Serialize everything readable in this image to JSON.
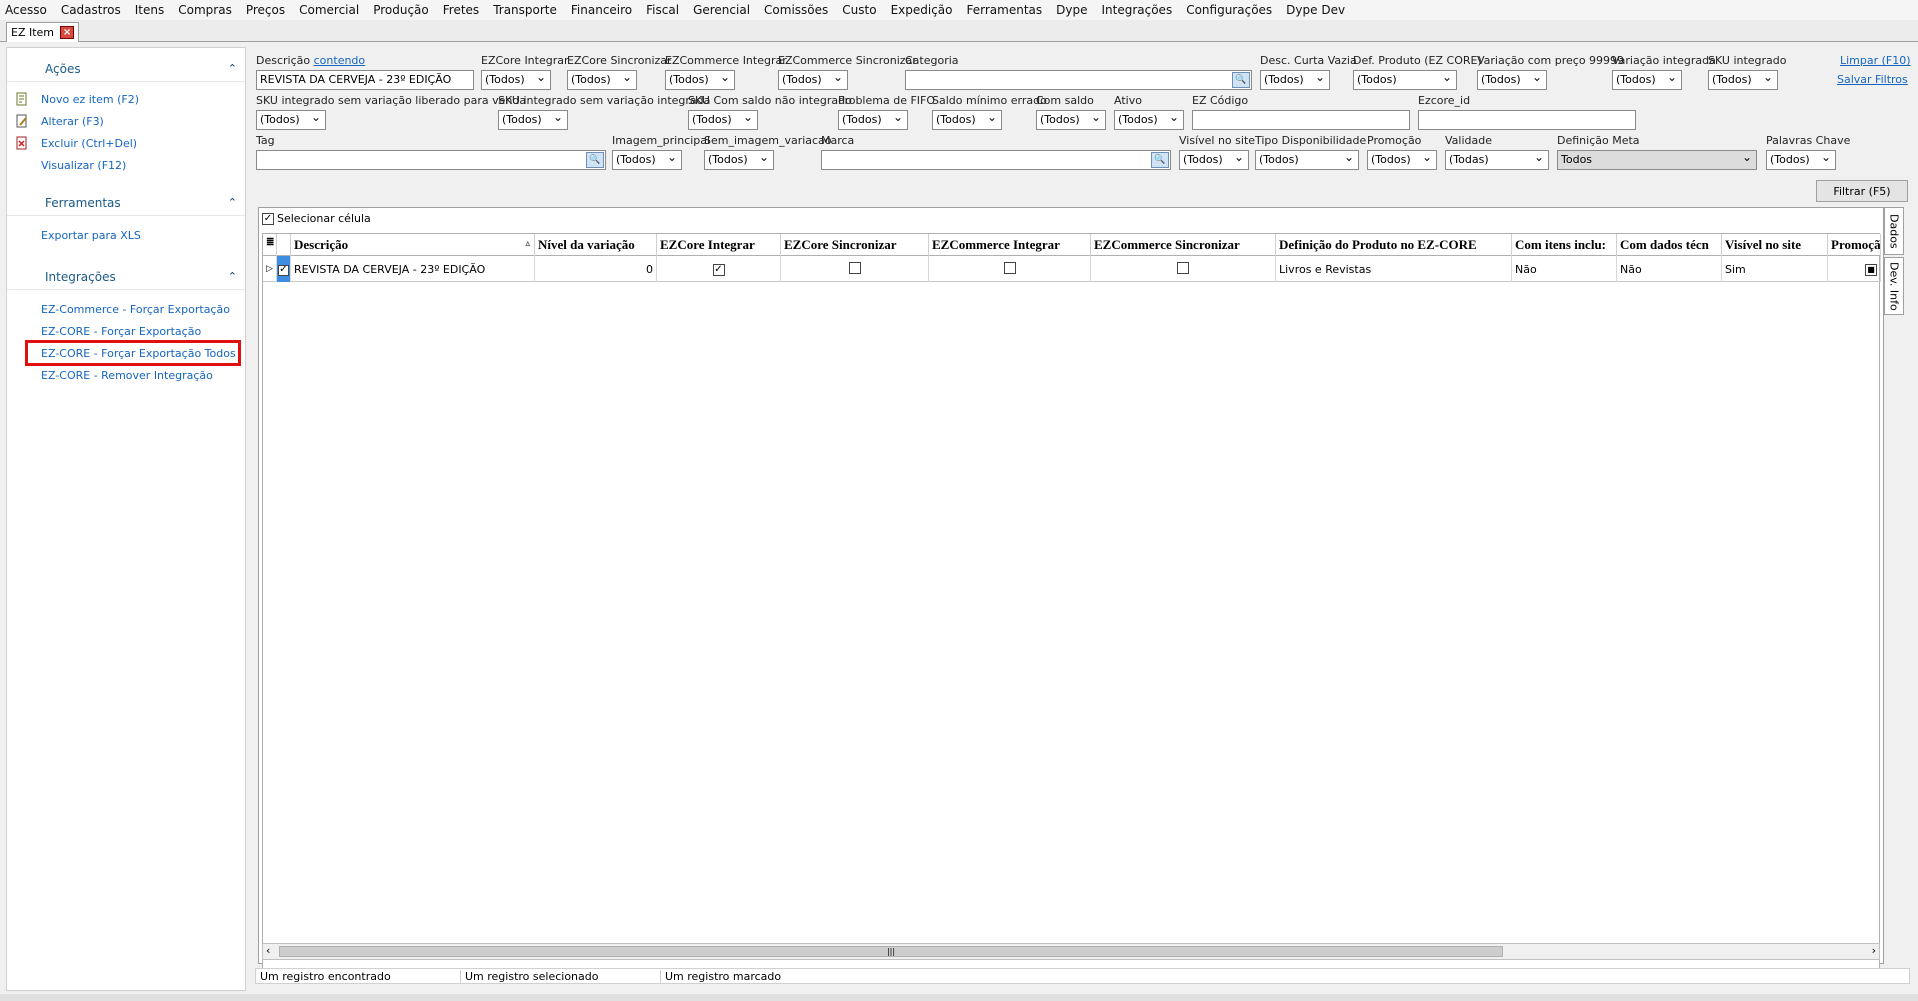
{
  "menu": [
    "Acesso",
    "Cadastros",
    "Itens",
    "Compras",
    "Preços",
    "Comercial",
    "Produção",
    "Fretes",
    "Transporte",
    "Financeiro",
    "Fiscal",
    "Gerencial",
    "Comissões",
    "Custo",
    "Expedição",
    "Ferramentas",
    "Dype",
    "Integrações",
    "Configurações",
    "Dype Dev"
  ],
  "tab": {
    "label": "EZ Item"
  },
  "sidebar": {
    "acoes": {
      "title": "Ações",
      "items": [
        "Novo ez item (F2)",
        "Alterar (F3)",
        "Excluir (Ctrl+Del)",
        "Visualizar (F12)"
      ]
    },
    "ferramentas": {
      "title": "Ferramentas",
      "items": [
        "Exportar para XLS"
      ]
    },
    "integracoes": {
      "title": "Integrações",
      "items": [
        "EZ-Commerce - Forçar Exportação",
        "EZ-CORE - Forçar Exportação",
        "EZ-CORE - Forçar Exportação Todos",
        "EZ-CORE - Remover Integração"
      ]
    }
  },
  "filters": {
    "descricao": {
      "label": "Descrição",
      "mode": "contendo",
      "value": "REVISTA DA CERVEJA - 23º EDIÇÃO"
    },
    "ezcore_integrar": {
      "label": "EZCore Integrar",
      "value": "(Todos)"
    },
    "ezcore_sincronizar": {
      "label": "EZCore Sincronizar",
      "value": "(Todos)"
    },
    "ezcommerce_integrar": {
      "label": "EZCommerce Integrar",
      "value": "(Todos)"
    },
    "ezcommerce_sincronizar": {
      "label": "EZCommerce Sincronizar",
      "value": "(Todos)"
    },
    "categoria": {
      "label": "Categoria",
      "value": ""
    },
    "desc_curta_vazia": {
      "label": "Desc. Curta Vazia",
      "value": "(Todos)"
    },
    "def_produto": {
      "label": "Def. Produto (EZ CORE)",
      "value": "(Todos)"
    },
    "variacao_preco": {
      "label": "Variação com preço 99999",
      "value": "(Todos)"
    },
    "variacao_integrada": {
      "label": "Variação integrada",
      "value": "(Todos)"
    },
    "sku_integrado": {
      "label": "SKU integrado",
      "value": "(Todos)"
    },
    "limpar": "Limpar (F10)",
    "salvar": "Salvar Filtros",
    "sku_sem_var": {
      "label": "SKU integrado sem variação liberado para venda",
      "value": "(Todos)"
    },
    "sku_sem_var_int": {
      "label": "SKU integrado sem variação integrada",
      "value": "(Todos)"
    },
    "sku_saldo": {
      "label": "SKU Com saldo não integrado",
      "value": "(Todos)"
    },
    "fifo": {
      "label": "Problema de FIFO",
      "value": "(Todos)"
    },
    "saldo_min": {
      "label": "Saldo mínimo errado",
      "value": "(Todos)"
    },
    "com_saldo": {
      "label": "Com saldo",
      "value": "(Todos)"
    },
    "ativo": {
      "label": "Ativo",
      "value": "(Todos)"
    },
    "ez_codigo": {
      "label": "EZ Código",
      "value": ""
    },
    "ezcore_id": {
      "label": "Ezcore_id",
      "value": ""
    },
    "tag": {
      "label": "Tag",
      "value": ""
    },
    "imagem_principal": {
      "label": "Imagem_principal",
      "value": "(Todos)"
    },
    "sem_imagem": {
      "label": "Sem_imagem_variacao",
      "value": "(Todos)"
    },
    "marca": {
      "label": "Marca",
      "value": ""
    },
    "visivel_site": {
      "label": "Visível no site",
      "value": "(Todos)"
    },
    "tipo_disp": {
      "label": "Tipo Disponibilidade",
      "value": "(Todos)"
    },
    "promocao": {
      "label": "Promoção",
      "value": "(Todos)"
    },
    "validade": {
      "label": "Validade",
      "value": "(Todas)"
    },
    "def_meta": {
      "label": "Definição Meta",
      "value": "Todos"
    },
    "palavras_chave": {
      "label": "Palavras Chave",
      "value": "(Todos)"
    },
    "filtrar": "Filtrar (F5)"
  },
  "grid": {
    "select_cell": "Selecionar célula",
    "columns": [
      "Descrição",
      "Nível da variação",
      "EZCore Integrar",
      "EZCore Sincronizar",
      "EZCommerce Integrar",
      "EZCommerce Sincronizar",
      "Definição do Produto no EZ-CORE",
      "Com itens inclu:",
      "Com dados técn",
      "Visível no site",
      "Promoçã"
    ],
    "row": {
      "descricao": "REVISTA DA CERVEJA - 23º EDIÇÃO",
      "nivel": "0",
      "ezcore_integrar": true,
      "ezcore_sincronizar": false,
      "ezcommerce_integrar": false,
      "ezcommerce_sincronizar": false,
      "definicao": "Livros e Revistas",
      "com_itens": "Não",
      "com_dados": "Não",
      "visivel": "Sim"
    }
  },
  "side_tabs": [
    "Dados",
    "Dev. Info"
  ],
  "status": {
    "found": "Um registro encontrado",
    "selected": "Um registro selecionado",
    "marked": "Um registro marcado"
  }
}
